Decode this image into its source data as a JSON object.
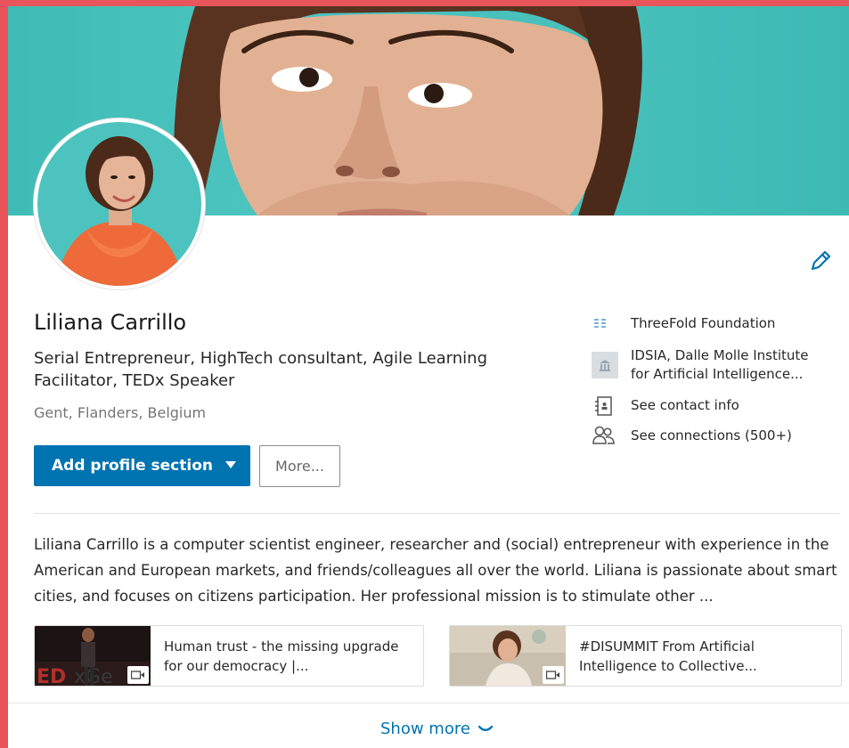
{
  "profile": {
    "name": "Liliana Carrillo",
    "headline": "Serial Entrepreneur, HighTech consultant, Agile Learning Facilitator, TEDx Speaker",
    "location": "Gent, Flanders, Belgium"
  },
  "actions": {
    "add_profile_section_label": "Add profile section",
    "more_label": "More..."
  },
  "sidebar": {
    "items": [
      {
        "label": "ThreeFold Foundation",
        "icon": "company-list-icon"
      },
      {
        "label": "IDSIA, Dalle Molle Institute for Artificial Intelligence...",
        "icon": "school-icon"
      },
      {
        "label": "See contact info",
        "icon": "contact-card-icon"
      },
      {
        "label": "See connections (500+)",
        "icon": "people-icon"
      }
    ]
  },
  "summary": {
    "text": "Liliana Carrillo is a computer scientist engineer, researcher and (social) entrepreneur with experience in the American and European markets, and friends/colleagues all over the world. Liliana is passionate about smart cities, and focuses on citizens participation. Her professional mission is to stimulate other ..."
  },
  "media": [
    {
      "title": "Human trust - the missing upgrade for our democracy |...",
      "icon": "video-icon"
    },
    {
      "title": "#DISUMMIT From Artificial Intelligence to Collective...",
      "icon": "video-icon"
    }
  ],
  "footer": {
    "show_more_label": "Show more"
  },
  "colors": {
    "accent": "#0073b1",
    "frame": "#e8555b",
    "banner": "#47c0bb"
  }
}
